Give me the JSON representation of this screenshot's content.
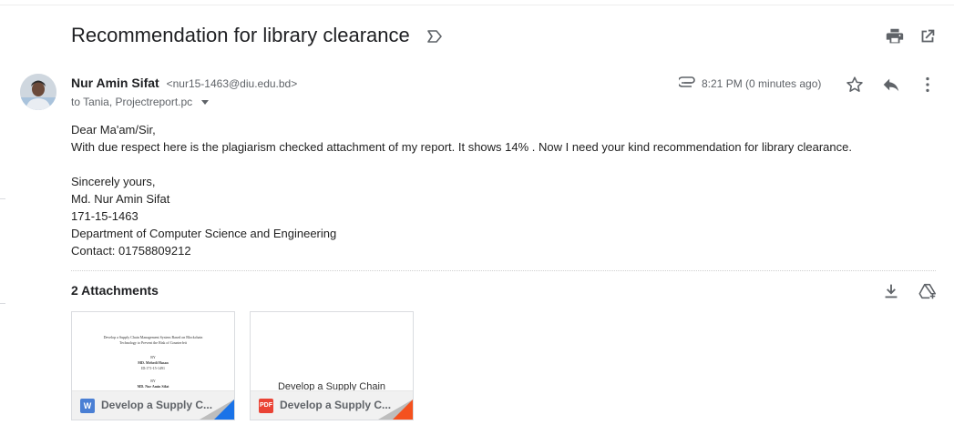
{
  "subject": "Recommendation for library clearance",
  "sender": {
    "name": "Nur Amin Sifat",
    "email": "<nur15-1463@diu.edu.bd>",
    "to": "to Tania, Projectreport.pc"
  },
  "meta": {
    "time": "8:21 PM (0 minutes ago)"
  },
  "body": {
    "greeting": "Dear Ma'am/Sir,",
    "message": "With due respect here is the plagiarism checked attachment of my report. It shows 14% . Now I need your kind recommendation for library clearance.",
    "closing": "Sincerely yours,",
    "sig_name": "Md. Nur Amin Sifat",
    "sig_id": "171-15-1463",
    "sig_dept": "Department of Computer Science and Engineering",
    "sig_contact": "Contact: 01758809212"
  },
  "attachments": {
    "title": "2 Attachments",
    "items": [
      {
        "name": "Develop a Supply C...",
        "type_badge": "W",
        "preview_lines": [
          "Develop a Supply Chain Management System Based on Blockchain",
          "Technology to Prevent the Risk of Counterfeit",
          "BY",
          "MD. Mehedi Hasan",
          "ID:171-15-1491",
          "BY",
          "MD. Nur Amin Sifat"
        ],
        "badge_color": "#4a7fd4",
        "corner_color": "#1a73e8"
      },
      {
        "name": "Develop a Supply C...",
        "type_badge": "PDF",
        "preview_text": "Develop a Supply Chain",
        "badge_color": "#ea4335",
        "corner_color": "#f4511e"
      }
    ]
  },
  "icons": {
    "label": "label-outline-icon",
    "print": "print-icon",
    "new_window": "open-in-new-icon",
    "attach": "paperclip-icon",
    "star": "star-outline-icon",
    "reply": "reply-icon",
    "more": "more-vert-icon",
    "download": "download-icon",
    "drive": "add-to-drive-icon"
  }
}
